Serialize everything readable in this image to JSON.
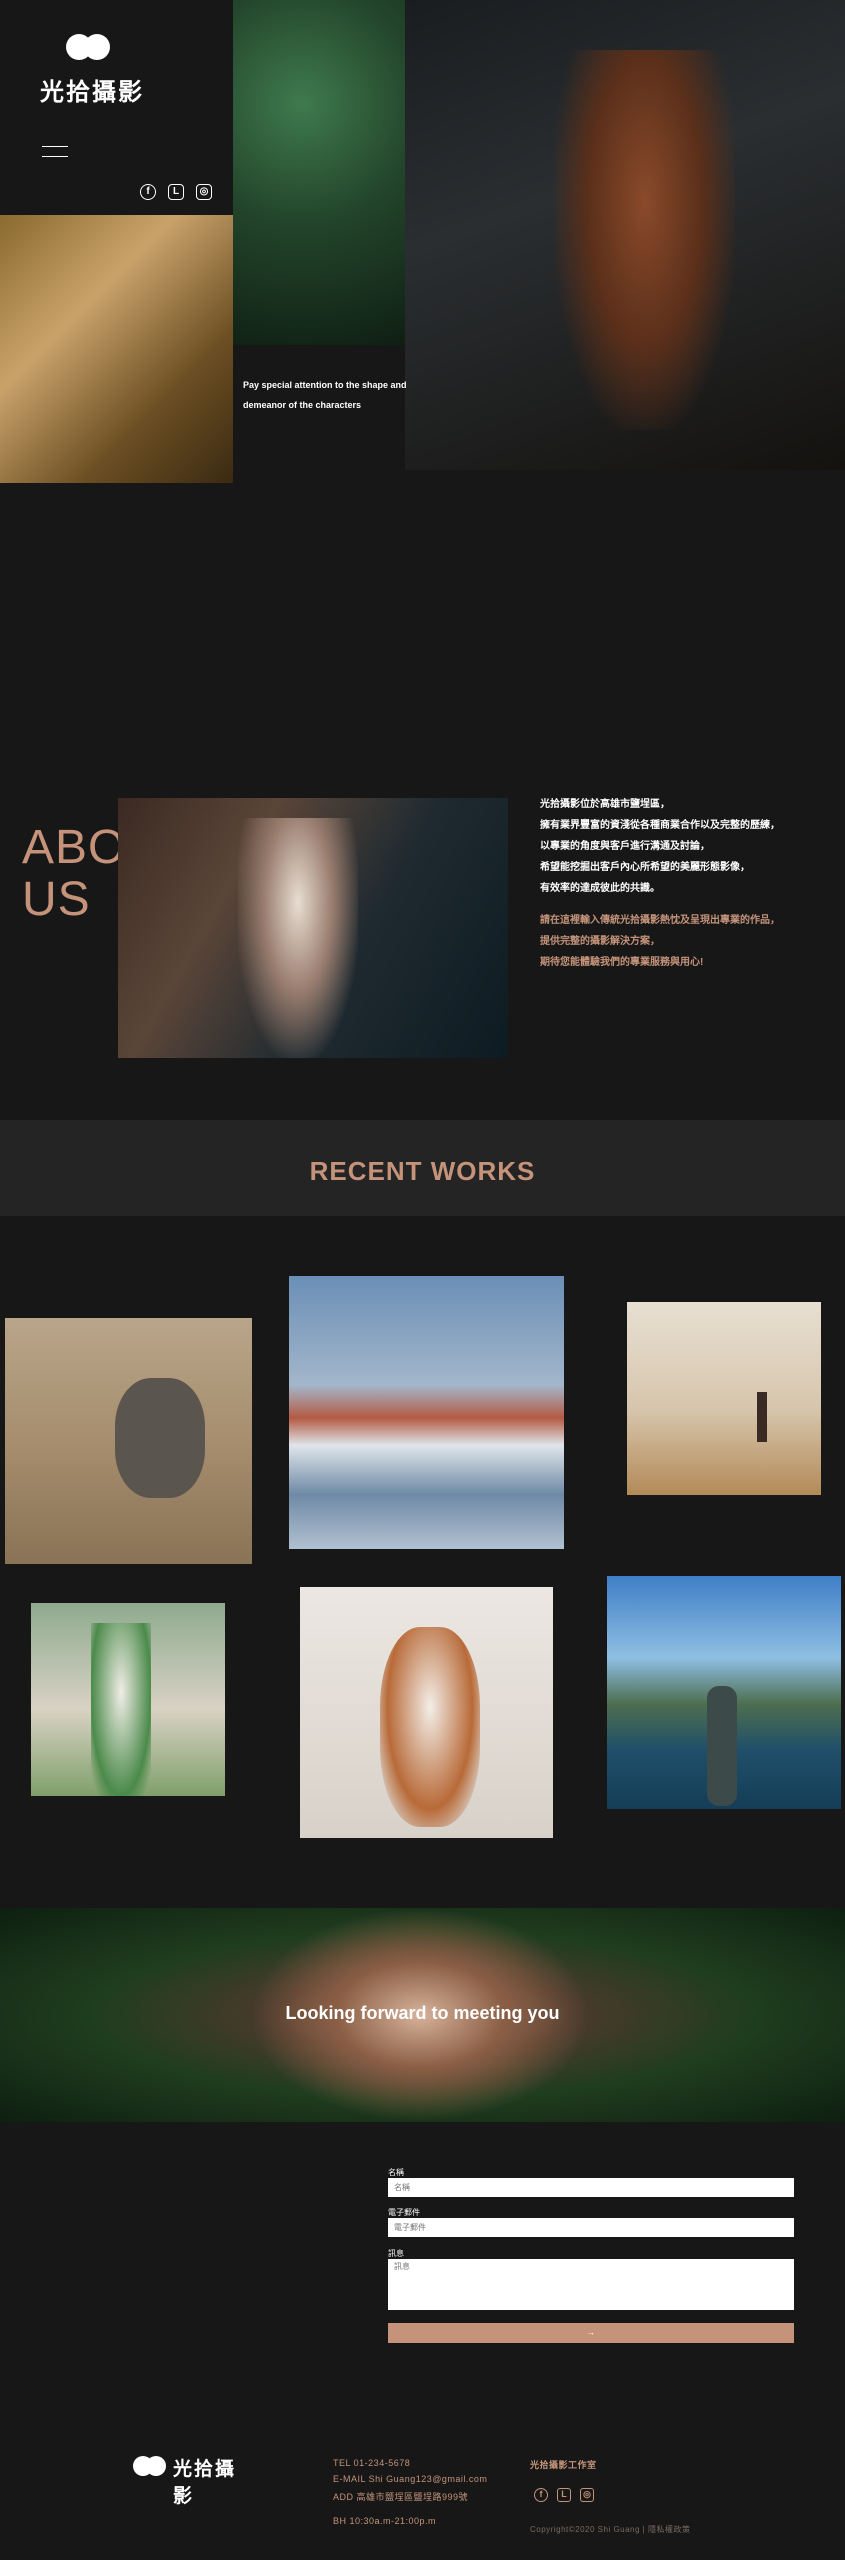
{
  "brand": {
    "name": "光拾攝影"
  },
  "header": {
    "menu_icon": "hamburger-icon",
    "social": [
      {
        "icon": "facebook-icon",
        "glyph": "f"
      },
      {
        "icon": "line-icon",
        "glyph": "L"
      },
      {
        "icon": "instagram-icon",
        "glyph": "◎"
      }
    ]
  },
  "hero": {
    "caption_line1": "Pay special attention to the shape and",
    "caption_line2": "demeanor of the characters"
  },
  "about": {
    "title_line1": "ABOUT",
    "title_line2": "US",
    "paragraph1": [
      "光拾攝影位於高雄市鹽埕區，",
      "擁有業界豐富的資淺從各種商業合作以及完整的歷練，",
      "以專業的角度與客戶進行溝通及討論，",
      "希望能挖掘出客戶內心所希望的美麗形態影像，",
      "有效率的達成彼此的共識。"
    ],
    "paragraph2": [
      "請在這裡輸入傳統光拾攝影熱忱及呈現出專業的作品，",
      "提供完整的攝影解決方案，",
      "期待您能體驗我們的專業服務與用心!"
    ]
  },
  "works": {
    "title": "RECENT WORKS"
  },
  "banner": {
    "text": "Looking forward to meeting you"
  },
  "form": {
    "name_label": "名稱",
    "name_placeholder": "名稱",
    "email_label": "電子郵件",
    "email_placeholder": "電子郵件",
    "message_label": "訊息",
    "message_placeholder": "訊息",
    "submit_label": "→"
  },
  "footer": {
    "tel": "TEL 01-234-5678",
    "email": "E-MAIL Shi Guang123@gmail.com",
    "address": "ADD 高雄市鹽埕區鹽埕路999號",
    "hours": "BH 10:30a.m-21:00p.m",
    "studio": "光拾攝影工作室",
    "copyright": "Copyright©2020 Shi Guang | 隱私權政策"
  },
  "colors": {
    "accent": "#c4937a",
    "background": "#171717",
    "band": "#242424"
  }
}
